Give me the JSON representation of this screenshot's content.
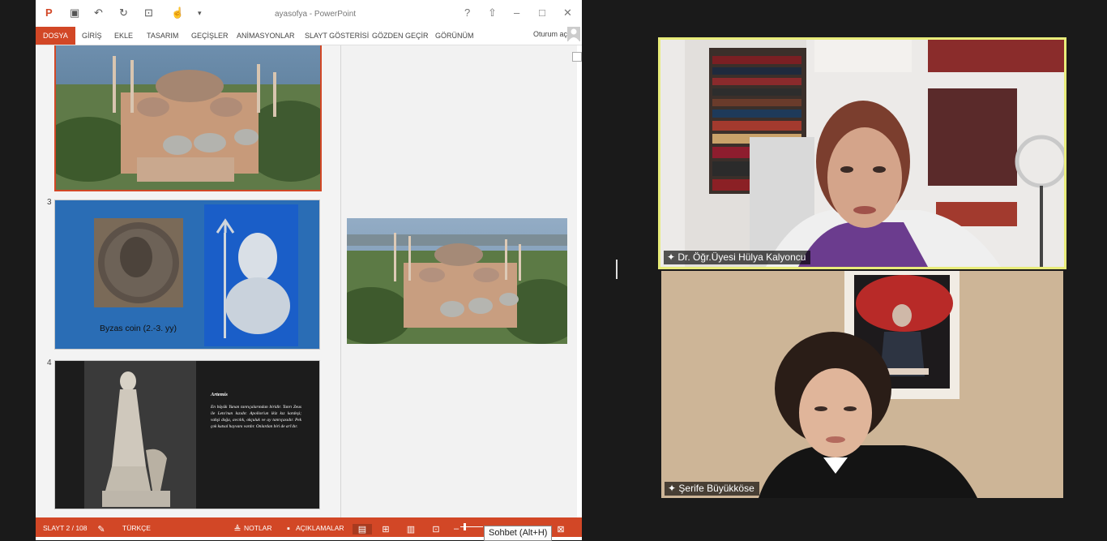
{
  "powerpoint": {
    "title": "ayasofya - PowerPoint",
    "help": "?",
    "signin": "Oturum aç",
    "ribbon_tabs": [
      "DOSYA",
      "GİRİŞ",
      "EKLE",
      "TASARIM",
      "GEÇİŞLER",
      "ANİMASYONLAR",
      "SLAYT GÖSTERİSİ",
      "GÖZDEN GEÇİR",
      "GÖRÜNÜM"
    ],
    "slides": {
      "s3_number": "3",
      "s4_number": "4",
      "s3_caption": "Byzas coin (2.-3. yy)",
      "s4_heading": "Artemis",
      "s4_body": "En büyük Yunan tanrıçalarından biridir. Tanrı Zeus ile Leto'nun kızıdır. Apollon'un ikiz kız kardeşi; vahşi doğa, avcılık, okçuluk ve ay tanrıçasıdır. Pek çok kutsal hayvanı vardır. Onlardan biri de ari'dır."
    },
    "status": {
      "slide_count": "SLAYT 2 / 108",
      "language": "TÜRKÇE",
      "notes": "NOTLAR",
      "comments": "AÇIKLAMALAR"
    }
  },
  "tooltip": "Sohbet (Alt+H)",
  "participants": [
    {
      "name": "Dr. Öğr.Üyesi Hülya Kalyoncu",
      "active_speaker": true
    },
    {
      "name": "Şerife Büyükköse",
      "active_speaker": false
    }
  ],
  "colors": {
    "accent": "#d24726",
    "speaker_border": "#e8ec7a",
    "background": "#1a1a1a"
  }
}
